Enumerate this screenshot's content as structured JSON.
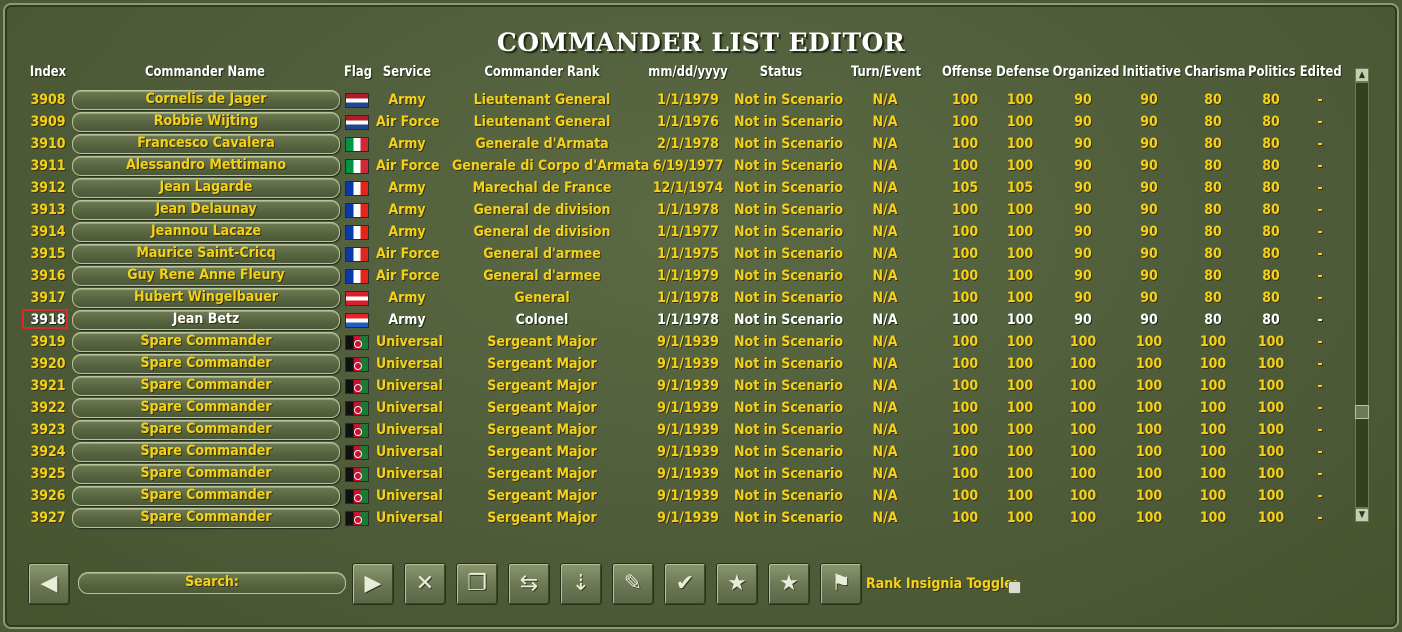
{
  "title": "COMMANDER LIST EDITOR",
  "columns": [
    "Index",
    "Commander Name",
    "Flag",
    "Service",
    "Commander Rank",
    "mm/dd/yyyy",
    "Status",
    "Turn/Event",
    "Offense",
    "Defense",
    "Organized",
    "Initiative",
    "Charisma",
    "Politics",
    "Edited"
  ],
  "rows": [
    {
      "index": "3908",
      "name": "Cornelis de Jager",
      "flag": "netherlands-flag-icon",
      "service": "Army",
      "rank": "Lieutenant General",
      "date": "1/1/1979",
      "status": "Not in Scenario",
      "turn": "N/A",
      "offense": "100",
      "defense": "100",
      "organized": "90",
      "initiative": "90",
      "charisma": "80",
      "politics": "80",
      "edited": "-"
    },
    {
      "index": "3909",
      "name": "Robbie Wijting",
      "flag": "netherlands-flag-icon",
      "service": "Air Force",
      "rank": "Lieutenant General",
      "date": "1/1/1976",
      "status": "Not in Scenario",
      "turn": "N/A",
      "offense": "100",
      "defense": "100",
      "organized": "90",
      "initiative": "90",
      "charisma": "80",
      "politics": "80",
      "edited": "-"
    },
    {
      "index": "3910",
      "name": "Francesco Cavalera",
      "flag": "italy-flag-icon",
      "service": "Army",
      "rank": "Generale d'Armata",
      "date": "2/1/1978",
      "status": "Not in Scenario",
      "turn": "N/A",
      "offense": "100",
      "defense": "100",
      "organized": "90",
      "initiative": "90",
      "charisma": "80",
      "politics": "80",
      "edited": "-"
    },
    {
      "index": "3911",
      "name": "Alessandro Mettimano",
      "flag": "italy-flag-icon",
      "service": "Air Force",
      "rank": "Generale di Corpo d'Armata",
      "date": "6/19/1977",
      "status": "Not in Scenario",
      "turn": "N/A",
      "offense": "100",
      "defense": "100",
      "organized": "90",
      "initiative": "90",
      "charisma": "80",
      "politics": "80",
      "edited": "-"
    },
    {
      "index": "3912",
      "name": "Jean Lagarde",
      "flag": "france-flag-icon",
      "service": "Army",
      "rank": "Marechal de France",
      "date": "12/1/1974",
      "status": "Not in Scenario",
      "turn": "N/A",
      "offense": "105",
      "defense": "105",
      "organized": "90",
      "initiative": "90",
      "charisma": "80",
      "politics": "80",
      "edited": "-"
    },
    {
      "index": "3913",
      "name": "Jean Delaunay",
      "flag": "france-flag-icon",
      "service": "Army",
      "rank": "General de division",
      "date": "1/1/1978",
      "status": "Not in Scenario",
      "turn": "N/A",
      "offense": "100",
      "defense": "100",
      "organized": "90",
      "initiative": "90",
      "charisma": "80",
      "politics": "80",
      "edited": "-"
    },
    {
      "index": "3914",
      "name": "Jeannou Lacaze",
      "flag": "france-flag-icon",
      "service": "Army",
      "rank": "General de division",
      "date": "1/1/1977",
      "status": "Not in Scenario",
      "turn": "N/A",
      "offense": "100",
      "defense": "100",
      "organized": "90",
      "initiative": "90",
      "charisma": "80",
      "politics": "80",
      "edited": "-"
    },
    {
      "index": "3915",
      "name": "Maurice Saint-Cricq",
      "flag": "france-flag-icon",
      "service": "Air Force",
      "rank": "General d'armee",
      "date": "1/1/1975",
      "status": "Not in Scenario",
      "turn": "N/A",
      "offense": "100",
      "defense": "100",
      "organized": "90",
      "initiative": "90",
      "charisma": "80",
      "politics": "80",
      "edited": "-"
    },
    {
      "index": "3916",
      "name": "Guy Rene Anne Fleury",
      "flag": "france-flag-icon",
      "service": "Air Force",
      "rank": "General d'armee",
      "date": "1/1/1979",
      "status": "Not in Scenario",
      "turn": "N/A",
      "offense": "100",
      "defense": "100",
      "organized": "90",
      "initiative": "90",
      "charisma": "80",
      "politics": "80",
      "edited": "-"
    },
    {
      "index": "3917",
      "name": "Hubert Wingelbauer",
      "flag": "austria-flag-icon",
      "service": "Army",
      "rank": "General",
      "date": "1/1/1978",
      "status": "Not in Scenario",
      "turn": "N/A",
      "offense": "100",
      "defense": "100",
      "organized": "90",
      "initiative": "90",
      "charisma": "80",
      "politics": "80",
      "edited": "-"
    },
    {
      "index": "3918",
      "name": "Jean Betz",
      "flag": "luxembourg-flag-icon",
      "service": "Army",
      "rank": "Colonel",
      "date": "1/1/1978",
      "status": "Not in Scenario",
      "turn": "N/A",
      "offense": "100",
      "defense": "100",
      "organized": "90",
      "initiative": "90",
      "charisma": "80",
      "politics": "80",
      "edited": "-",
      "selected": true
    },
    {
      "index": "3919",
      "name": "Spare Commander",
      "flag": "afghanistan-flag-icon",
      "service": "Universal",
      "rank": "Sergeant Major",
      "date": "9/1/1939",
      "status": "Not in Scenario",
      "turn": "N/A",
      "offense": "100",
      "defense": "100",
      "organized": "100",
      "initiative": "100",
      "charisma": "100",
      "politics": "100",
      "edited": "-"
    },
    {
      "index": "3920",
      "name": "Spare Commander",
      "flag": "afghanistan-flag-icon",
      "service": "Universal",
      "rank": "Sergeant Major",
      "date": "9/1/1939",
      "status": "Not in Scenario",
      "turn": "N/A",
      "offense": "100",
      "defense": "100",
      "organized": "100",
      "initiative": "100",
      "charisma": "100",
      "politics": "100",
      "edited": "-"
    },
    {
      "index": "3921",
      "name": "Spare Commander",
      "flag": "afghanistan-flag-icon",
      "service": "Universal",
      "rank": "Sergeant Major",
      "date": "9/1/1939",
      "status": "Not in Scenario",
      "turn": "N/A",
      "offense": "100",
      "defense": "100",
      "organized": "100",
      "initiative": "100",
      "charisma": "100",
      "politics": "100",
      "edited": "-"
    },
    {
      "index": "3922",
      "name": "Spare Commander",
      "flag": "afghanistan-flag-icon",
      "service": "Universal",
      "rank": "Sergeant Major",
      "date": "9/1/1939",
      "status": "Not in Scenario",
      "turn": "N/A",
      "offense": "100",
      "defense": "100",
      "organized": "100",
      "initiative": "100",
      "charisma": "100",
      "politics": "100",
      "edited": "-"
    },
    {
      "index": "3923",
      "name": "Spare Commander",
      "flag": "afghanistan-flag-icon",
      "service": "Universal",
      "rank": "Sergeant Major",
      "date": "9/1/1939",
      "status": "Not in Scenario",
      "turn": "N/A",
      "offense": "100",
      "defense": "100",
      "organized": "100",
      "initiative": "100",
      "charisma": "100",
      "politics": "100",
      "edited": "-"
    },
    {
      "index": "3924",
      "name": "Spare Commander",
      "flag": "afghanistan-flag-icon",
      "service": "Universal",
      "rank": "Sergeant Major",
      "date": "9/1/1939",
      "status": "Not in Scenario",
      "turn": "N/A",
      "offense": "100",
      "defense": "100",
      "organized": "100",
      "initiative": "100",
      "charisma": "100",
      "politics": "100",
      "edited": "-"
    },
    {
      "index": "3925",
      "name": "Spare Commander",
      "flag": "afghanistan-flag-icon",
      "service": "Universal",
      "rank": "Sergeant Major",
      "date": "9/1/1939",
      "status": "Not in Scenario",
      "turn": "N/A",
      "offense": "100",
      "defense": "100",
      "organized": "100",
      "initiative": "100",
      "charisma": "100",
      "politics": "100",
      "edited": "-"
    },
    {
      "index": "3926",
      "name": "Spare Commander",
      "flag": "afghanistan-flag-icon",
      "service": "Universal",
      "rank": "Sergeant Major",
      "date": "9/1/1939",
      "status": "Not in Scenario",
      "turn": "N/A",
      "offense": "100",
      "defense": "100",
      "organized": "100",
      "initiative": "100",
      "charisma": "100",
      "politics": "100",
      "edited": "-"
    },
    {
      "index": "3927",
      "name": "Spare Commander",
      "flag": "afghanistan-flag-icon",
      "service": "Universal",
      "rank": "Sergeant Major",
      "date": "9/1/1939",
      "status": "Not in Scenario",
      "turn": "N/A",
      "offense": "100",
      "defense": "100",
      "organized": "100",
      "initiative": "100",
      "charisma": "100",
      "politics": "100",
      "edited": "-"
    }
  ],
  "toolbar": {
    "search_label": "Search:",
    "rank_insignia_label": "Rank Insignia Toggle:",
    "buttons": [
      {
        "name": "prev-button",
        "icon": "arrow-left-icon",
        "glyph": "◀"
      },
      {
        "name": "next-button",
        "icon": "arrow-right-icon",
        "glyph": "▶"
      },
      {
        "name": "delete-button",
        "icon": "x-icon",
        "glyph": "✕"
      },
      {
        "name": "copy-button",
        "icon": "copy-icon",
        "glyph": "❐"
      },
      {
        "name": "swap-button",
        "icon": "swap-icon",
        "glyph": "⇆"
      },
      {
        "name": "sort-button",
        "icon": "sort-down-icon",
        "glyph": "⇣"
      },
      {
        "name": "edit-button",
        "icon": "pen-icon",
        "glyph": "✎"
      },
      {
        "name": "confirm-button",
        "icon": "check-icon",
        "glyph": "✔"
      },
      {
        "name": "promote-button",
        "icon": "star-up-icon",
        "glyph": "★"
      },
      {
        "name": "demote-button",
        "icon": "star-down-icon",
        "glyph": "★"
      },
      {
        "name": "flag-button",
        "icon": "flag-icon",
        "glyph": "⚑"
      }
    ]
  },
  "colors": {
    "text_yellow": "#f2d21a",
    "selected_text": "#ffffff",
    "selection_border": "#d62b2b",
    "background": "#4f5c3a"
  }
}
